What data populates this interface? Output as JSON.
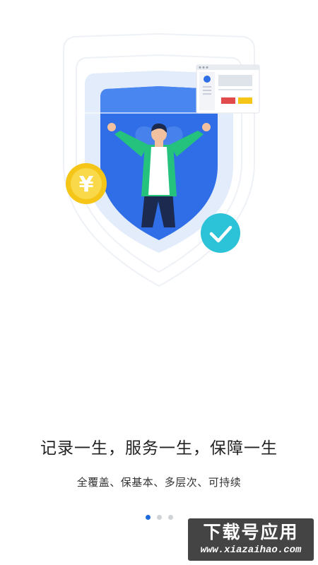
{
  "onboarding": {
    "headline": "记录一生，服务一生，保障一生",
    "subline": "全覆盖、保基本、多层次、可持续",
    "page_indicator": {
      "total": 3,
      "active": 1
    }
  },
  "illustration": {
    "coin_symbol": "¥",
    "icons": [
      "shield-icon",
      "person-icon",
      "yuan-coin-icon",
      "checkmark-icon",
      "document-icon",
      "heart-icon"
    ]
  },
  "watermark": {
    "title": "下载号应用",
    "url": "www.xiazaihao.com"
  },
  "colors": {
    "shield_blue": "#2f6ee6",
    "coin_yellow": "#f5c518",
    "check_teal": "#2cc2d8",
    "active_dot": "#1f6bdc"
  }
}
